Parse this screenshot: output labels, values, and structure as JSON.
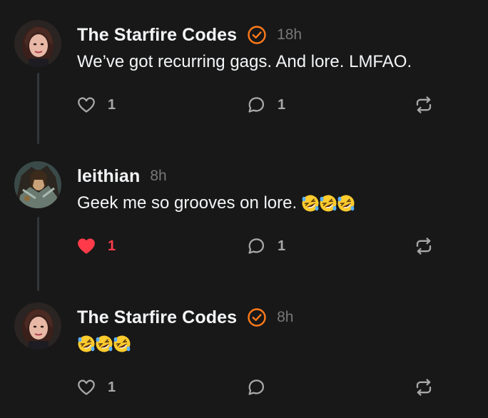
{
  "posts": [
    {
      "author": "The Starfire Codes",
      "verified": true,
      "time": "18h",
      "text": "We’ve got recurring gags. And lore. LMFAO.",
      "emoji_count": 0,
      "likes": "1",
      "liked": false,
      "comments": "1",
      "avatar_icon": "woman-portrait-avatar"
    },
    {
      "author": "leithian",
      "verified": false,
      "time": "8h",
      "text": "Geek me so grooves on lore.",
      "emoji_count": 3,
      "likes": "1",
      "liked": true,
      "comments": "1",
      "avatar_icon": "warrior-art-avatar"
    },
    {
      "author": "The Starfire Codes",
      "verified": true,
      "time": "8h",
      "text": "",
      "emoji_count": 3,
      "likes": "1",
      "liked": false,
      "comments": "",
      "avatar_icon": "woman-portrait-avatar"
    }
  ],
  "icons": {
    "like": "heart-icon",
    "comment": "comment-bubble-icon",
    "repost": "repost-icon",
    "verified": "verified-badge-icon",
    "emoji": "rolling-on-floor-laughing-emoji"
  },
  "colors": {
    "background": "#181818",
    "text": "#f3f5f7",
    "muted": "#777777",
    "action": "#a8a8a8",
    "liked": "#ff3b4a",
    "verified": "#ff7a1a",
    "thread_line": "#333638"
  }
}
